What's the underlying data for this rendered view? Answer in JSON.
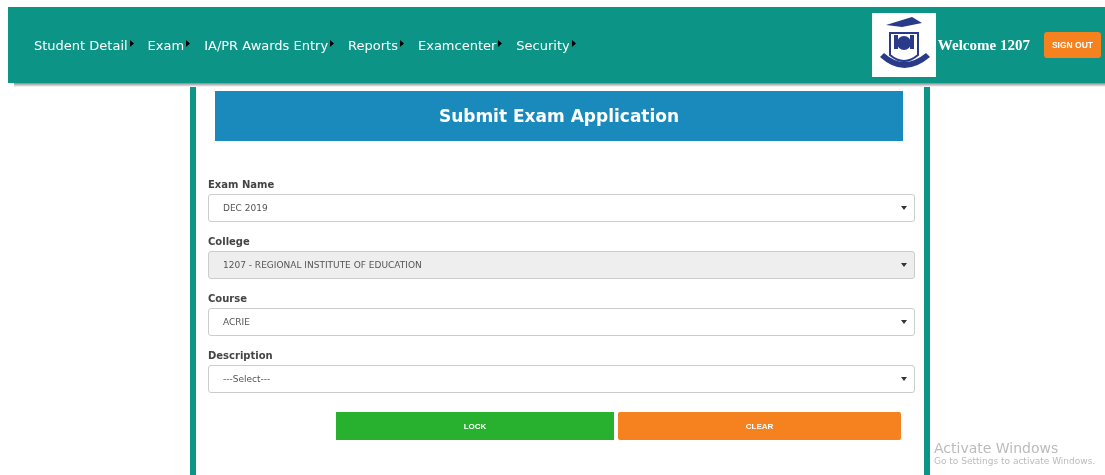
{
  "nav": {
    "items": [
      {
        "label": "Student Detail"
      },
      {
        "label": "Exam"
      },
      {
        "label": "IA/PR Awards Entry"
      },
      {
        "label": "Reports"
      },
      {
        "label": "Examcenter"
      },
      {
        "label": "Security"
      }
    ],
    "welcome": "Welcome 1207",
    "sign_out": "SIGN OUT"
  },
  "form": {
    "title": "Submit Exam Application",
    "fields": [
      {
        "label": "Exam Name",
        "value": "DEC 2019",
        "disabled": false
      },
      {
        "label": "College",
        "value": "1207 - REGIONAL INSTITUTE OF EDUCATION",
        "disabled": true
      },
      {
        "label": "Course",
        "value": "ACRIE",
        "disabled": false
      },
      {
        "label": "Description",
        "value": "---Select---",
        "disabled": false
      }
    ],
    "buttons": [
      {
        "label": "LOCK",
        "kind": "primary"
      },
      {
        "label": "CLEAR",
        "kind": "secondary"
      }
    ]
  },
  "os_notice": {
    "title": "Activate Windows",
    "message": "Go to Settings to activate Windows."
  }
}
